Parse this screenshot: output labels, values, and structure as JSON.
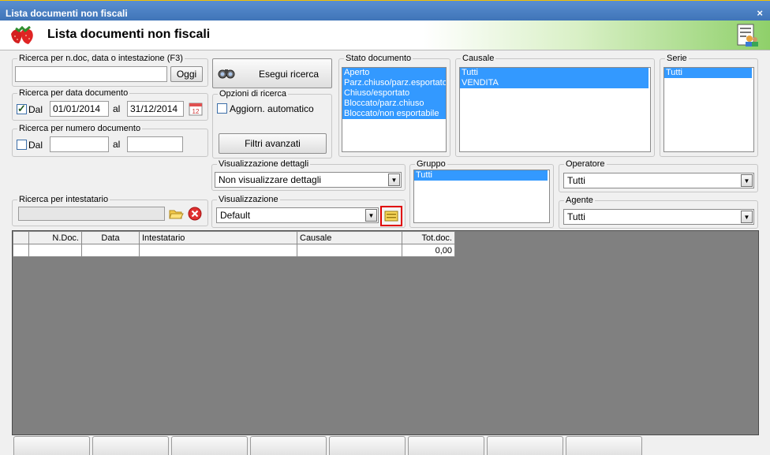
{
  "window": {
    "title": "Lista documenti non fiscali",
    "close_glyph": "×"
  },
  "banner": {
    "title": "Lista documenti non fiscali",
    "logo_icon": "strawberry-icon",
    "report_icon": "report-users-icon"
  },
  "search_text": {
    "legend": "Ricerca per n.doc, data o intestazione (F3)",
    "value": "",
    "today_label": "Oggi"
  },
  "date_search": {
    "legend": "Ricerca per data documento",
    "checked": true,
    "from_label": "Dal",
    "from_value": "01/01/2014",
    "to_label": "al",
    "to_value": "31/12/2014",
    "calendar_icon": "calendar-icon"
  },
  "number_search": {
    "legend": "Ricerca per numero documento",
    "checked": false,
    "from_label": "Dal",
    "from_value": "",
    "to_label": "al",
    "to_value": ""
  },
  "holder_search": {
    "legend": "Ricerca per intestatario",
    "value": "",
    "open_icon": "folder-open-icon",
    "clear_icon": "clear-red-icon"
  },
  "search_button": {
    "label": "Esegui ricerca",
    "icon": "binoculars-icon"
  },
  "options": {
    "legend": "Opzioni di ricerca",
    "auto_update_label": "Aggiorn. automatico",
    "auto_update_checked": false,
    "advanced_filters_label": "Filtri avanzati"
  },
  "details_view": {
    "legend": "Visualizzazione dettagli",
    "selected": "Non visualizzare dettagli"
  },
  "view": {
    "legend": "Visualizzazione",
    "selected": "Default",
    "edit_icon": "layout-edit-icon"
  },
  "status": {
    "legend": "Stato documento",
    "items": [
      "Aperto",
      "Parz.chiuso/parz.esportato",
      "Chiuso/esportato",
      "Bloccato/parz.chiuso",
      "Bloccato/non esportabile"
    ]
  },
  "causale": {
    "legend": "Causale",
    "items": [
      "Tutti",
      "VENDITA"
    ]
  },
  "serie": {
    "legend": "Serie",
    "items": [
      "Tutti"
    ]
  },
  "gruppo": {
    "legend": "Gruppo",
    "items": [
      "Tutti"
    ]
  },
  "operatore": {
    "legend": "Operatore",
    "selected": "Tutti"
  },
  "agente": {
    "legend": "Agente",
    "selected": "Tutti"
  },
  "grid": {
    "columns": [
      "",
      "N.Doc.",
      "Data",
      "Intestatario",
      "Causale",
      "Tot.doc."
    ],
    "rows": [
      [
        "",
        "",
        "",
        "",
        "",
        "0,00"
      ]
    ]
  },
  "colors": {
    "title_bar": "#4a80c4",
    "selection": "#3399ff",
    "grid_bg": "#808080",
    "highlight_border": "#e00000"
  }
}
